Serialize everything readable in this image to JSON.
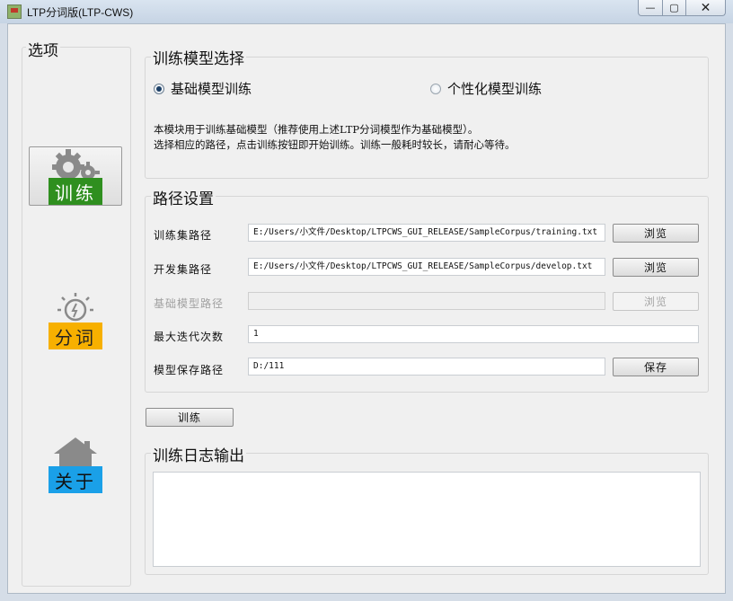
{
  "window": {
    "title": "LTP分词版(LTP-CWS)",
    "controls": {
      "minimize": "—",
      "maximize": "▢",
      "close": "✕"
    }
  },
  "sidebar": {
    "title": "选项",
    "items": [
      {
        "label": "训练",
        "icon": "gears-icon",
        "selected": true,
        "color": "#2f8f1f"
      },
      {
        "label": "分词",
        "icon": "clock-icon",
        "selected": false,
        "color": "#f7b000"
      },
      {
        "label": "关于",
        "icon": "house-icon",
        "selected": false,
        "color": "#1aa0e8"
      }
    ]
  },
  "model_selection": {
    "title": "训练模型选择",
    "options": [
      {
        "label": "基础模型训练",
        "checked": true
      },
      {
        "label": "个性化模型训练",
        "checked": false
      }
    ],
    "description_lines": [
      "本模块用于训练基础模型（推荐使用上述LTP分词模型作为基础模型）。",
      "选择相应的路径，点击训练按钮即开始训练。训练一般耗时较长，请耐心等待。"
    ]
  },
  "path_settings": {
    "title": "路径设置",
    "fields": [
      {
        "label": "训练集路径",
        "value": "E:/Users/小文件/Desktop/LTPCWS_GUI_RELEASE/SampleCorpus/training.txt",
        "button": "浏览",
        "disabled": false
      },
      {
        "label": "开发集路径",
        "value": "E:/Users/小文件/Desktop/LTPCWS_GUI_RELEASE/SampleCorpus/develop.txt",
        "button": "浏览",
        "disabled": false
      },
      {
        "label": "基础模型路径",
        "value": "",
        "button": "浏览",
        "disabled": true
      },
      {
        "label": "最大迭代次数",
        "value": "1",
        "button": null,
        "disabled": false
      },
      {
        "label": "模型保存路径",
        "value": "D:/111",
        "button": "保存",
        "disabled": false
      }
    ]
  },
  "train_button": "训练",
  "log": {
    "title": "训练日志输出",
    "content": ""
  }
}
